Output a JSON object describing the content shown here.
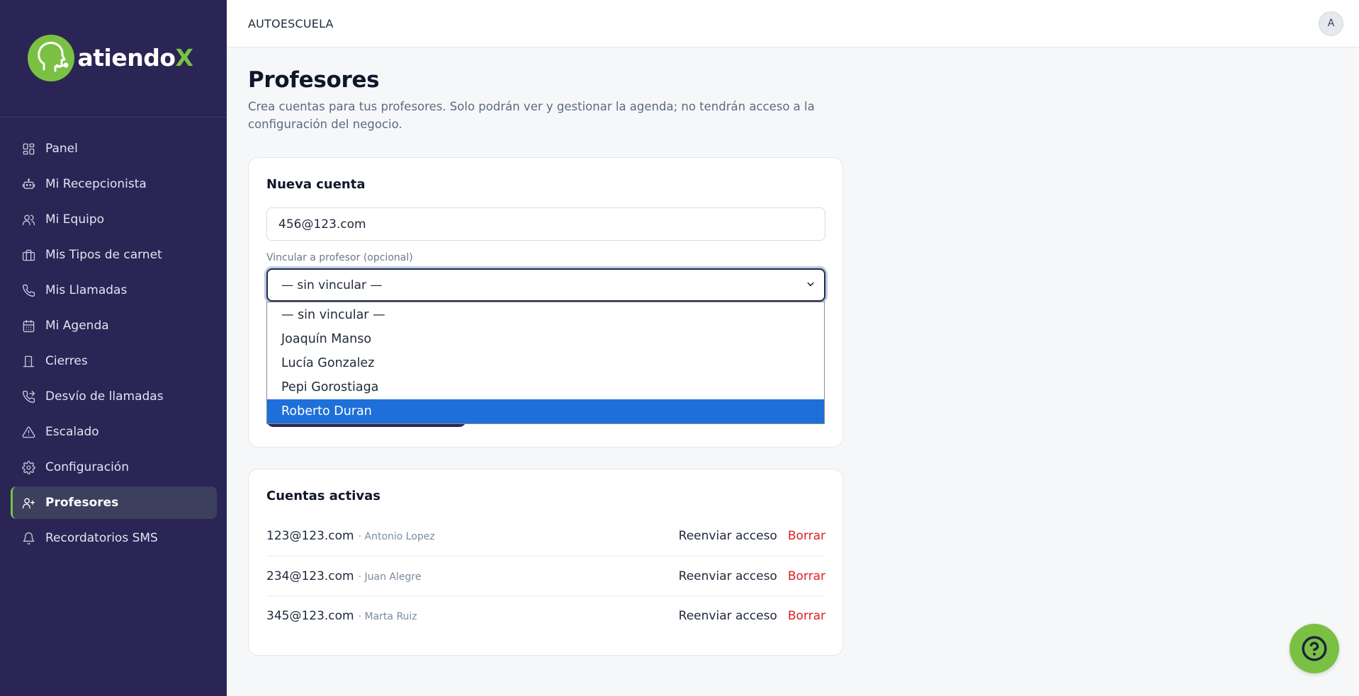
{
  "app": {
    "logo_text_main": "atiendo",
    "logo_text_accent": "X",
    "brand_color": "#2a2554",
    "accent_color": "#7ac143"
  },
  "topbar": {
    "business_name": "AUTOESCUELA",
    "avatar_initial": "A"
  },
  "sidebar": {
    "items": [
      {
        "label": "Panel",
        "icon": "dashboard-icon"
      },
      {
        "label": "Mi Recepcionista",
        "icon": "robot-icon"
      },
      {
        "label": "Mi Equipo",
        "icon": "users-icon"
      },
      {
        "label": "Mis Tipos de carnet",
        "icon": "briefcase-icon"
      },
      {
        "label": "Mis Llamadas",
        "icon": "phone-icon"
      },
      {
        "label": "Mi Agenda",
        "icon": "calendar-icon"
      },
      {
        "label": "Cierres",
        "icon": "door-icon"
      },
      {
        "label": "Desvío de llamadas",
        "icon": "phone-forward-icon"
      },
      {
        "label": "Escalado",
        "icon": "warning-icon"
      },
      {
        "label": "Configuración",
        "icon": "gear-icon"
      },
      {
        "label": "Profesores",
        "icon": "user-plus-icon",
        "active": true
      },
      {
        "label": "Recordatorios SMS",
        "icon": "bell-icon"
      }
    ]
  },
  "page": {
    "title": "Profesores",
    "description": "Crea cuentas para tus profesores. Solo podrán ver y gestionar la agenda; no tendrán acceso a la configuración del negocio."
  },
  "new_account": {
    "title": "Nueva cuenta",
    "email_value": "456@123.com",
    "link_label": "Vincular a profesor (opcional)",
    "select_value": "— sin vincular —",
    "options": [
      "— sin vincular —",
      "Joaquín Manso",
      "Lucía Gonzalez",
      "Pepi Gorostiaga",
      "Roberto Duran"
    ],
    "highlighted_option": "Roberto Duran"
  },
  "active_accounts": {
    "title": "Cuentas activas",
    "rows": [
      {
        "email": "123@123.com",
        "professor": "· Antonio Lopez",
        "resend": "Reenviar acceso",
        "delete": "Borrar"
      },
      {
        "email": "234@123.com",
        "professor": "· Juan Alegre",
        "resend": "Reenviar acceso",
        "delete": "Borrar"
      },
      {
        "email": "345@123.com",
        "professor": "· Marta Ruiz",
        "resend": "Reenviar acceso",
        "delete": "Borrar"
      }
    ]
  },
  "help": {
    "icon": "help-icon"
  }
}
